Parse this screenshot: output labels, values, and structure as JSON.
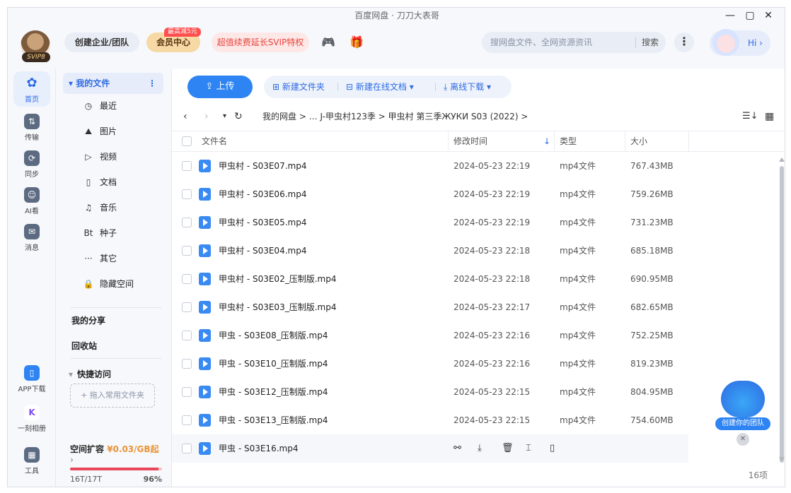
{
  "window": {
    "title": "百度网盘 · 刀刀大表哥"
  },
  "topbar": {
    "svip_badge": "SVIP8",
    "team_button": "创建企业/团队",
    "vip_button": "会员中心",
    "vip_tag": "最高减5元",
    "renew_button": "超值续费延长SVIP特权",
    "search_placeholder": "搜网盘文件、全网资源资讯",
    "search_button": "搜索",
    "hi_text": "Hi ›"
  },
  "rail": {
    "home": "首页",
    "transfer": "传输",
    "sync": "同步",
    "ai": "AI看",
    "messages": "消息",
    "app_download": "APP下载",
    "yike": "一刻相册",
    "tools": "工具"
  },
  "sidebar": {
    "my_files": "我的文件",
    "items": [
      {
        "icon": "clock-icon",
        "glyph": "◷",
        "label": "最近"
      },
      {
        "icon": "image-icon",
        "glyph": "⛰",
        "label": "图片"
      },
      {
        "icon": "video-icon",
        "glyph": "▷",
        "label": "视频"
      },
      {
        "icon": "doc-icon",
        "glyph": "▯",
        "label": "文档"
      },
      {
        "icon": "music-icon",
        "glyph": "♫",
        "label": "音乐"
      },
      {
        "icon": "bt-icon",
        "glyph": "Bt",
        "label": "种子"
      },
      {
        "icon": "more-icon",
        "glyph": "···",
        "label": "其它"
      },
      {
        "icon": "lock-icon",
        "glyph": "🔒",
        "label": "隐藏空间"
      }
    ],
    "my_share": "我的分享",
    "recycle": "回收站",
    "quick_access": "快捷访问",
    "drop_hint": "+ 拖入常用文件夹",
    "space_label": "空间扩容",
    "space_price": "¥0.03/GB起",
    "space_usage": "16T/17T",
    "space_percent": "96%",
    "space_fraction": 0.96
  },
  "toolbar": {
    "upload": "上传",
    "new_folder": "新建文件夹",
    "new_doc": "新建在线文档 ▾",
    "offline": "离线下载 ▾"
  },
  "breadcrumb": "我的网盘  >  …  J-甲虫村123季  >  甲虫村 第三季ЖУКИ S03 (2022)  >",
  "columns": {
    "name": "文件名",
    "time": "修改时间",
    "type": "类型",
    "size": "大小"
  },
  "files": [
    {
      "name": "甲虫村 - S03E07.mp4",
      "time": "2024-05-23 22:19",
      "type": "mp4文件",
      "size": "767.43MB"
    },
    {
      "name": "甲虫村 - S03E06.mp4",
      "time": "2024-05-23 22:19",
      "type": "mp4文件",
      "size": "759.26MB"
    },
    {
      "name": "甲虫村 - S03E05.mp4",
      "time": "2024-05-23 22:19",
      "type": "mp4文件",
      "size": "731.23MB"
    },
    {
      "name": "甲虫村 - S03E04.mp4",
      "time": "2024-05-23 22:18",
      "type": "mp4文件",
      "size": "685.18MB"
    },
    {
      "name": "甲虫村 - S03E02_压制版.mp4",
      "time": "2024-05-23 22:18",
      "type": "mp4文件",
      "size": "690.95MB"
    },
    {
      "name": "甲虫村 - S03E03_压制版.mp4",
      "time": "2024-05-23 22:17",
      "type": "mp4文件",
      "size": "682.65MB"
    },
    {
      "name": "甲虫 - S03E08_压制版.mp4",
      "time": "2024-05-23 22:16",
      "type": "mp4文件",
      "size": "752.25MB"
    },
    {
      "name": "甲虫 - S03E10_压制版.mp4",
      "time": "2024-05-23 22:16",
      "type": "mp4文件",
      "size": "819.23MB"
    },
    {
      "name": "甲虫 - S03E12_压制版.mp4",
      "time": "2024-05-23 22:15",
      "type": "mp4文件",
      "size": "804.95MB"
    },
    {
      "name": "甲虫 - S03E13_压制版.mp4",
      "time": "2024-05-23 22:15",
      "type": "mp4文件",
      "size": "754.60MB"
    }
  ],
  "hover_file": {
    "name": "甲虫 - S03E16.mp4"
  },
  "item_count": "16项",
  "float_widget": {
    "label": "创建你的团队"
  }
}
